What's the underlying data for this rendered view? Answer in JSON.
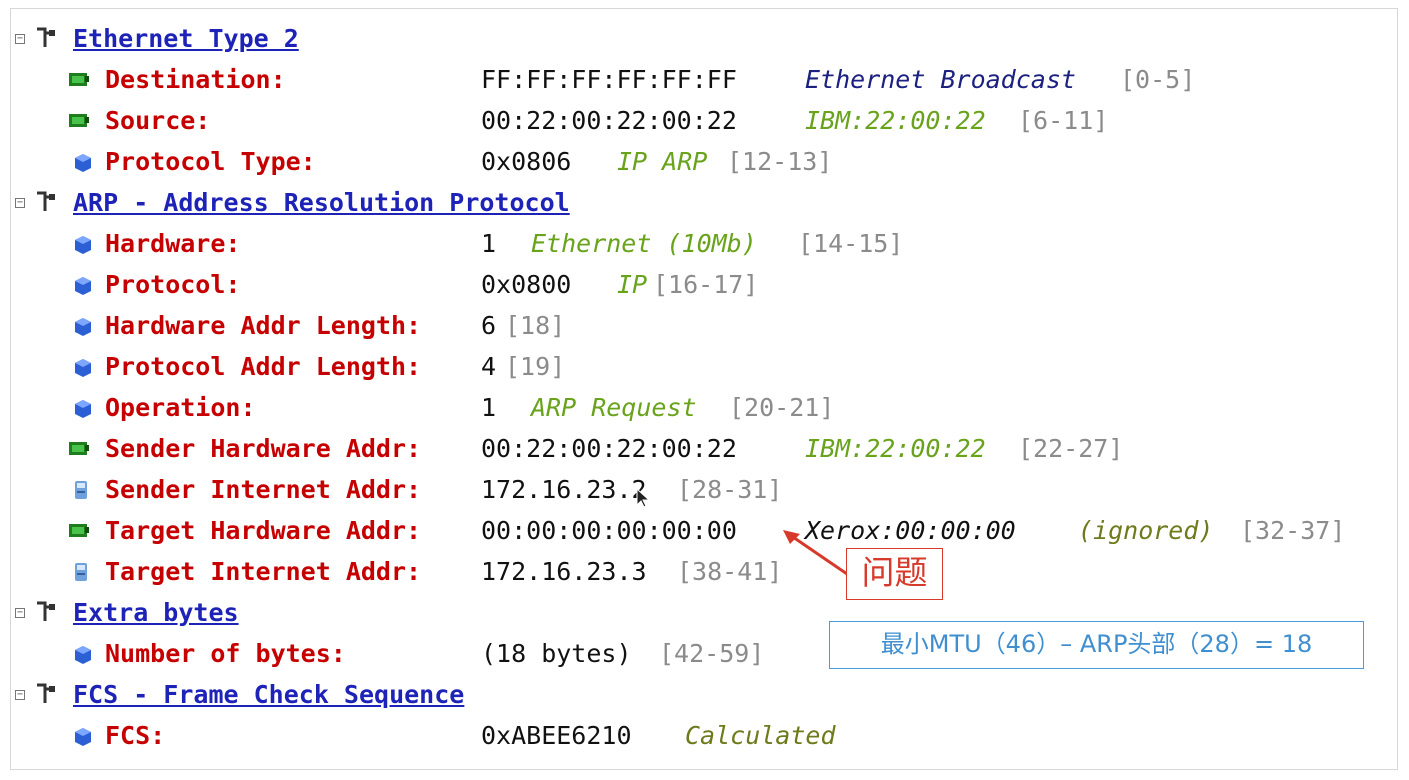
{
  "sections": [
    {
      "title": "Ethernet Type 2",
      "fields": [
        {
          "label": "Destination:",
          "value": "FF:FF:FF:FF:FF:FF",
          "decode": "Ethernet Broadcast",
          "decode_color": "blue",
          "range": "[0-5]",
          "icon": "network-card-icon"
        },
        {
          "label": "Source:",
          "value": "00:22:00:22:00:22",
          "decode": "IBM:22:00:22",
          "decode_color": "green",
          "range": "[6-11]",
          "icon": "network-card-icon"
        },
        {
          "label": "Protocol Type:",
          "value": "0x0806",
          "decode": "IP ARP",
          "decode_color": "green",
          "range": "[12-13]",
          "icon": "cube-icon"
        }
      ]
    },
    {
      "title": "ARP - Address Resolution Protocol",
      "fields": [
        {
          "label": "Hardware:",
          "value": "1",
          "decode": "Ethernet (10Mb)",
          "decode_color": "green",
          "range": "[14-15]",
          "icon": "cube-icon"
        },
        {
          "label": "Protocol:",
          "value": "0x0800",
          "decode": "IP",
          "decode_color": "green",
          "range": "[16-17]",
          "icon": "cube-icon"
        },
        {
          "label": "Hardware Addr Length:",
          "value": "6",
          "decode": "",
          "decode_color": "green",
          "range": "[18]",
          "icon": "cube-icon"
        },
        {
          "label": "Protocol Addr Length:",
          "value": "4",
          "decode": "",
          "decode_color": "green",
          "range": "[19]",
          "icon": "cube-icon"
        },
        {
          "label": "Operation:",
          "value": "1",
          "decode": "ARP Request",
          "decode_color": "green",
          "range": "[20-21]",
          "icon": "cube-icon"
        },
        {
          "label": "Sender Hardware Addr:",
          "value": "00:22:00:22:00:22",
          "decode": "IBM:22:00:22",
          "decode_color": "green",
          "range": "[22-27]",
          "icon": "network-card-icon"
        },
        {
          "label": "Sender Internet Addr:",
          "value": "172.16.23.2",
          "decode": "",
          "decode_color": "green",
          "range": "[28-31]",
          "icon": "computer-icon"
        },
        {
          "label": "Target Hardware Addr:",
          "value": "00:00:00:00:00:00",
          "decode": "Xerox:00:00:00",
          "decode_extra": "(ignored)",
          "decode_color": "black",
          "range": "[32-37]",
          "icon": "network-card-icon"
        },
        {
          "label": "Target Internet Addr:",
          "value": "172.16.23.3",
          "decode": "",
          "decode_color": "green",
          "range": "[38-41]",
          "icon": "computer-icon"
        }
      ]
    },
    {
      "title": "Extra bytes",
      "fields": [
        {
          "label": "Number of bytes:",
          "value": "(18 bytes)",
          "decode": "",
          "decode_color": "green",
          "range": "[42-59]",
          "icon": "cube-icon"
        }
      ]
    },
    {
      "title": "FCS - Frame Check Sequence",
      "fields": [
        {
          "label": "FCS:",
          "value": "0xABEE6210",
          "decode": "Calculated",
          "decode_color": "olive",
          "range": "",
          "icon": "cube-icon"
        }
      ]
    }
  ],
  "annotations": {
    "problem_label": "问题",
    "mtu_note": "最小MTU（46）– ARP头部（28）= 18"
  },
  "colors": {
    "section_title": "#1e23b8",
    "field_label": "#c60000",
    "decode_green": "#68a31b",
    "decode_blue": "#1c2080",
    "annotation_red": "#d73a2b",
    "annotation_blue": "#3f8fd0"
  }
}
